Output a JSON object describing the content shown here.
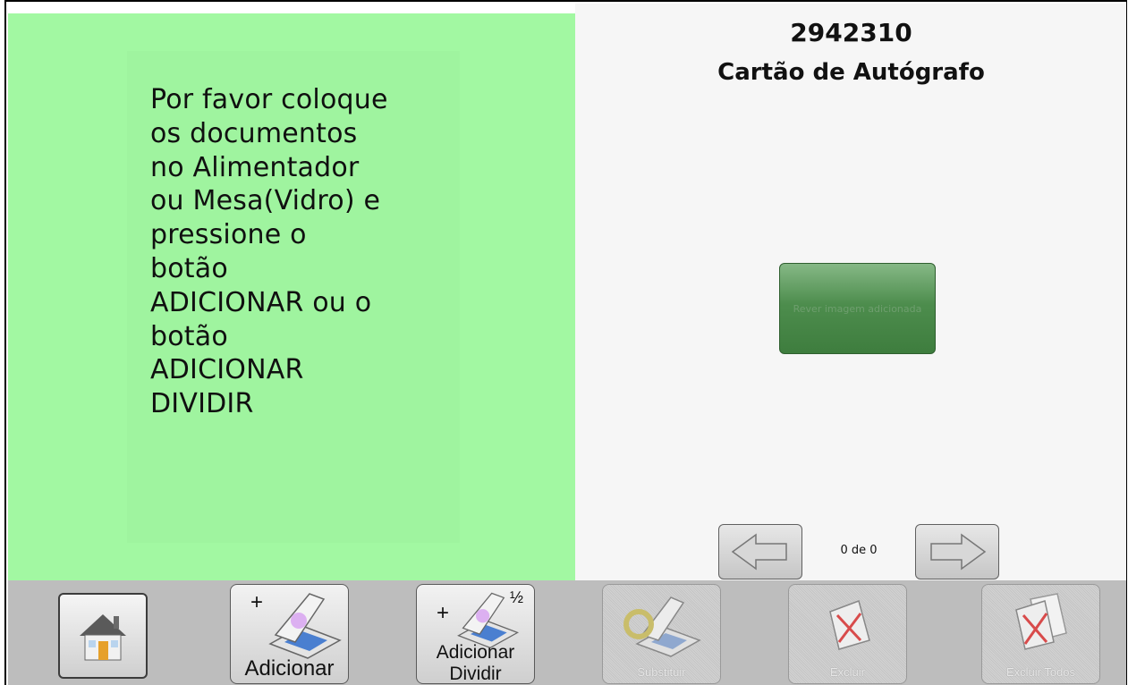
{
  "instruction": {
    "text": "Por favor coloque\nos documentos\nno Alimentador\nou Mesa(Vidro) e\npressione o\nbotão\nADICIONAR ou o\nbotão\nADICIONAR\nDIVIDIR"
  },
  "document": {
    "number": "2942310",
    "type": "Cartão de Autógrafo"
  },
  "action_button": {
    "label": "Rever imagem adicionada"
  },
  "pager": {
    "counter": "0 de 0"
  },
  "toolbar": {
    "home_icon": "house-icon",
    "add_label": "Adicionar",
    "add_split_label_line1": "Adicionar",
    "add_split_label_line2": "Dividir",
    "split_badge": "½",
    "plus_symbol": "+",
    "replace_label": "Substituir",
    "delete_label": "Excluir",
    "delete_all_label": "Excluir Todos"
  },
  "colors": {
    "left_panel": "#a2f8a2",
    "right_panel": "#f6f6f6",
    "action_button": "#4d8d4d",
    "toolbar": "#bdbdbd"
  }
}
